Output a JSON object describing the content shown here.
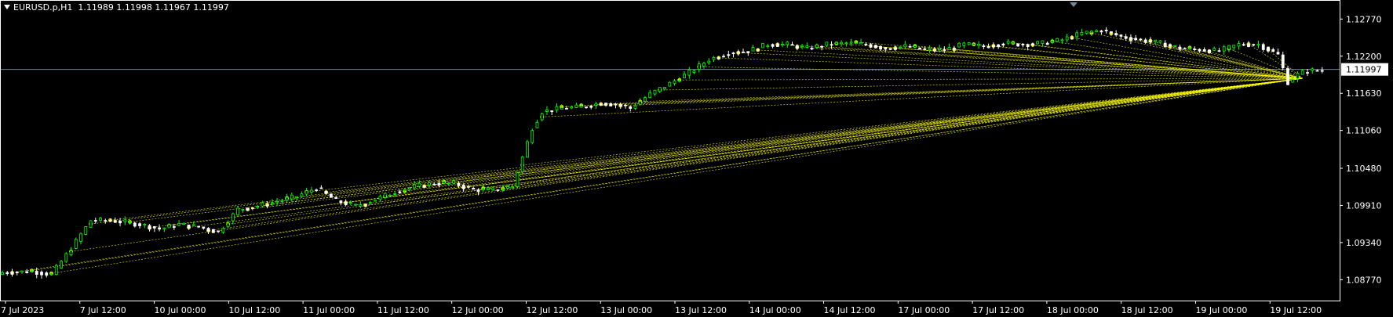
{
  "header": {
    "symbol": "EURUSD.p,H1",
    "ohlc": "1.11989 1.11998 1.11967 1.11997"
  },
  "colors": {
    "background": "#000000",
    "bull": "#00ff00",
    "bear": "#ffffff",
    "objects": "#ffff00",
    "bid_line": "#778899",
    "axis": "#ffffff"
  },
  "chart_data": {
    "type": "candlestick",
    "title": "EURUSD.p,H1",
    "ylim": [
      1.0845,
      1.1305
    ],
    "yticks": [
      "1.12770",
      "1.12200",
      "1.11630",
      "1.11060",
      "1.10480",
      "1.09910",
      "1.09340",
      "1.08770"
    ],
    "yticks_values": [
      1.1277,
      1.122,
      1.1163,
      1.1106,
      1.1048,
      1.0991,
      1.0934,
      1.0877
    ],
    "xticks": [
      "7 Jul 2023",
      "7 Jul 12:00",
      "10 Jul 00:00",
      "10 Jul 12:00",
      "11 Jul 00:00",
      "11 Jul 12:00",
      "12 Jul 00:00",
      "12 Jul 12:00",
      "13 Jul 00:00",
      "13 Jul 12:00",
      "14 Jul 00:00",
      "14 Jul 12:00",
      "17 Jul 00:00",
      "17 Jul 12:00",
      "18 Jul 00:00",
      "18 Jul 12:00",
      "19 Jul 00:00",
      "19 Jul 12:00"
    ],
    "current_price": "1.11997",
    "current_price_value": 1.11997,
    "price_path": [
      [
        0,
        1.0888
      ],
      [
        6,
        1.089
      ],
      [
        10,
        1.0885
      ],
      [
        14,
        1.0925
      ],
      [
        18,
        1.0968
      ],
      [
        22,
        1.0968
      ],
      [
        28,
        1.0962
      ],
      [
        32,
        1.0955
      ],
      [
        36,
        1.0962
      ],
      [
        40,
        1.0958
      ],
      [
        44,
        1.095
      ],
      [
        48,
        1.0985
      ],
      [
        52,
        1.099
      ],
      [
        56,
        1.0997
      ],
      [
        60,
        1.1005
      ],
      [
        64,
        1.1018
      ],
      [
        68,
        1.0998
      ],
      [
        72,
        1.099
      ],
      [
        76,
        1.1
      ],
      [
        80,
        1.1012
      ],
      [
        84,
        1.102
      ],
      [
        88,
        1.1025
      ],
      [
        92,
        1.1025
      ],
      [
        96,
        1.1015
      ],
      [
        100,
        1.1015
      ],
      [
        104,
        1.102
      ],
      [
        106,
        1.1065
      ],
      [
        108,
        1.111
      ],
      [
        110,
        1.1135
      ],
      [
        114,
        1.114
      ],
      [
        118,
        1.1142
      ],
      [
        122,
        1.1148
      ],
      [
        126,
        1.1145
      ],
      [
        128,
        1.114
      ],
      [
        132,
        1.1162
      ],
      [
        136,
        1.1178
      ],
      [
        140,
        1.1195
      ],
      [
        144,
        1.1215
      ],
      [
        148,
        1.1225
      ],
      [
        152,
        1.1228
      ],
      [
        156,
        1.1238
      ],
      [
        160,
        1.1238
      ],
      [
        164,
        1.1232
      ],
      [
        168,
        1.1238
      ],
      [
        172,
        1.124
      ],
      [
        176,
        1.1238
      ],
      [
        180,
        1.1232
      ],
      [
        184,
        1.1235
      ],
      [
        188,
        1.123
      ],
      [
        192,
        1.123
      ],
      [
        196,
        1.1238
      ],
      [
        200,
        1.1235
      ],
      [
        204,
        1.124
      ],
      [
        208,
        1.1238
      ],
      [
        212,
        1.124
      ],
      [
        216,
        1.1245
      ],
      [
        220,
        1.1255
      ],
      [
        224,
        1.126
      ],
      [
        228,
        1.125
      ],
      [
        232,
        1.1245
      ],
      [
        236,
        1.124
      ],
      [
        240,
        1.1232
      ],
      [
        244,
        1.123
      ],
      [
        248,
        1.1228
      ],
      [
        252,
        1.1238
      ],
      [
        256,
        1.1238
      ],
      [
        258,
        1.123
      ],
      [
        260,
        1.1222
      ],
      [
        262,
        1.118
      ],
      [
        264,
        1.1192
      ],
      [
        266,
        1.1198
      ]
    ]
  }
}
